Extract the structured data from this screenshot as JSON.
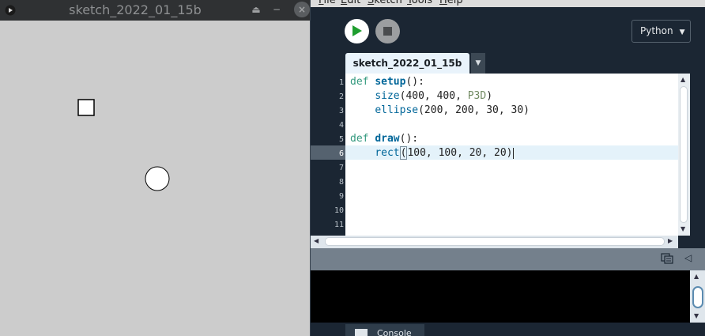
{
  "sketch_window": {
    "title": "sketch_2022_01_15b",
    "close_glyph": "×",
    "eject_glyph": "⏏",
    "min_glyph": "−"
  },
  "menu": {
    "items": [
      {
        "label": "File",
        "u": "F",
        "rest": "ile"
      },
      {
        "label": "Edit",
        "u": "E",
        "rest": "dit"
      },
      {
        "label": "Sketch",
        "u": "S",
        "rest": "ketch"
      },
      {
        "label": "Tools",
        "u": "T",
        "rest": "ools"
      },
      {
        "label": "Help",
        "u": "H",
        "rest": "elp"
      }
    ]
  },
  "toolbar": {
    "mode": "Python",
    "mode_arrow": "▼"
  },
  "tabs": {
    "active": "sketch_2022_01_15b",
    "menu_arrow": "▼"
  },
  "editor": {
    "line_numbers": [
      "1",
      "2",
      "3",
      "4",
      "5",
      "6",
      "7",
      "8",
      "9",
      "10",
      "11"
    ],
    "current_line": 6,
    "code": {
      "l1_kw": "def",
      "l1_fn": "setup",
      "l1_rest": "():",
      "l2_call": "size",
      "l2_args": "(400, 400, ",
      "l2_const": "P3D",
      "l2_end": ")",
      "l3_call": "ellipse",
      "l3_args": "(200, 200, 30, 30)",
      "l5_kw": "def",
      "l5_fn": "draw",
      "l5_rest": "():",
      "l6_call": "rect",
      "l6_open": "(",
      "l6_args": "100, 100, 20, 20)"
    }
  },
  "console": {
    "tab_label": "Console",
    "collapse_glyph": "◁"
  },
  "colors": {
    "sketch_background": "#cccccc",
    "ide_background": "#1b2633",
    "keyword": "#33997e",
    "function": "#006699",
    "constant": "#718a62"
  },
  "icons": [
    "sketch-app-icon",
    "eject-icon",
    "minimize-icon",
    "close-icon",
    "play-icon",
    "stop-icon",
    "dropdown-arrow-icon",
    "copy-icon",
    "collapse-icon",
    "console-icon"
  ]
}
